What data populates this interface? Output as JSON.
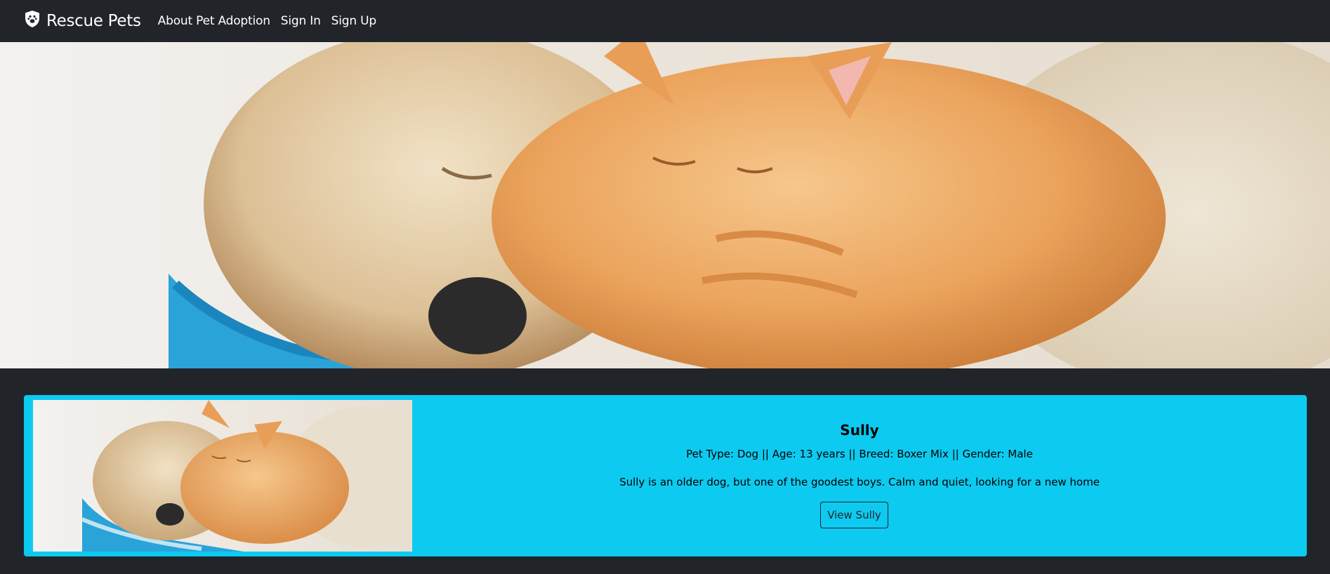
{
  "navbar": {
    "brand": "Rescue Pets",
    "brand_icon": "shield-paw-icon",
    "links": [
      "About Pet Adoption",
      "Sign In",
      "Sign Up"
    ]
  },
  "hero": {
    "image": "sleeping-puppy-and-kitten-photo"
  },
  "pet_card": {
    "image": "sleeping-puppy-and-kitten-photo",
    "name": "Sully",
    "info": "Pet Type: Dog || Age: 13 years || Breed: Boxer Mix || Gender: Male",
    "description": "Sully is an older dog, but one of the goodest boys. Calm and quiet, looking for a new home",
    "button_label": "View Sully",
    "background_color": "#0dcaf0"
  }
}
